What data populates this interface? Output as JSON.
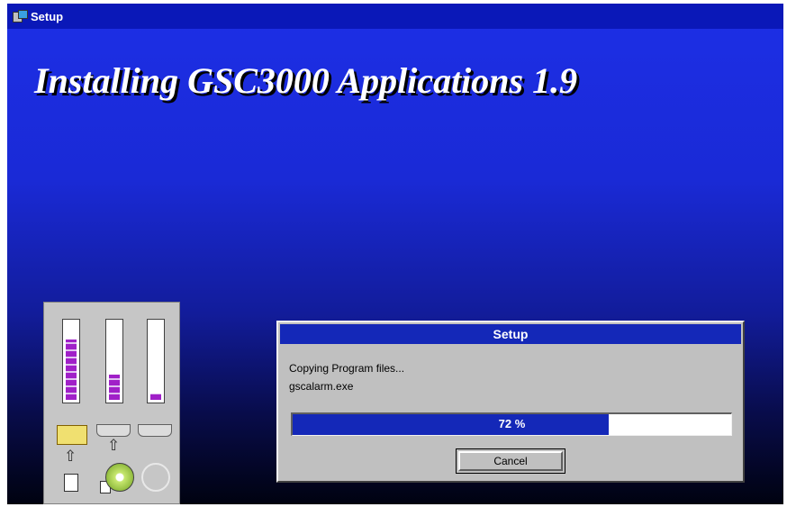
{
  "window": {
    "title": "Setup",
    "icon": "setup-app-icon",
    "banner": "Installing GSC3000 Applications 1.9",
    "background_top": "#1d2fe6",
    "background_bottom": "#000210"
  },
  "disk_meters": {
    "meters": [
      {
        "label": "destination-folder-space",
        "fill_fraction": 0.78
      },
      {
        "label": "source-disk-space",
        "fill_fraction": 0.33
      },
      {
        "label": "third-drive-space",
        "fill_fraction": 0.08
      }
    ],
    "fill_color": "#a020c8",
    "icons": [
      "folder-icon",
      "up-arrow-icon",
      "document-icon",
      "cd-disc-icon",
      "faded-disc-icon"
    ]
  },
  "dialog": {
    "title": "Setup",
    "status_line": "Copying Program files...",
    "current_file": "gscalarm.exe",
    "progress_percent": 72,
    "progress_text": "72 %",
    "cancel_label": "Cancel",
    "accent": "#1428b8"
  }
}
